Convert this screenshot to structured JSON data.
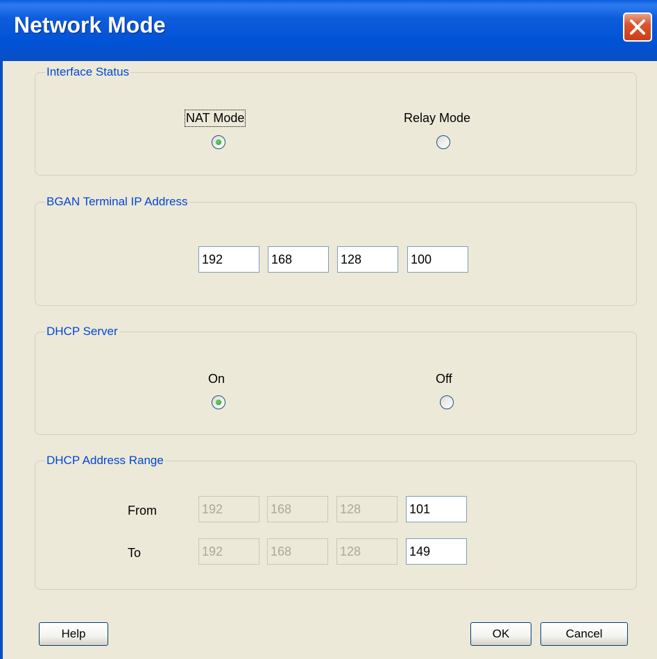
{
  "window": {
    "title": "Network Mode"
  },
  "interface_status": {
    "legend": "Interface Status",
    "options": [
      {
        "label": "NAT Mode",
        "selected": true
      },
      {
        "label": "Relay Mode",
        "selected": false
      }
    ]
  },
  "terminal_ip": {
    "legend": "BGAN Terminal IP Address",
    "octets": [
      "192",
      "168",
      "128",
      "100"
    ]
  },
  "dhcp_server": {
    "legend": "DHCP Server",
    "options": [
      {
        "label": "On",
        "selected": true
      },
      {
        "label": "Off",
        "selected": false
      }
    ]
  },
  "dhcp_range": {
    "legend": "DHCP Address Range",
    "from_label": "From",
    "from": [
      "192",
      "168",
      "128",
      "101"
    ],
    "to_label": "To",
    "to": [
      "192",
      "168",
      "128",
      "149"
    ]
  },
  "buttons": {
    "help": "Help",
    "ok": "OK",
    "cancel": "Cancel"
  },
  "colors": {
    "legend_text": "#0046D5",
    "title_bar": "#0052D6",
    "client_bg": "#ECE9D8"
  },
  "icons": {
    "close": "close-icon"
  }
}
